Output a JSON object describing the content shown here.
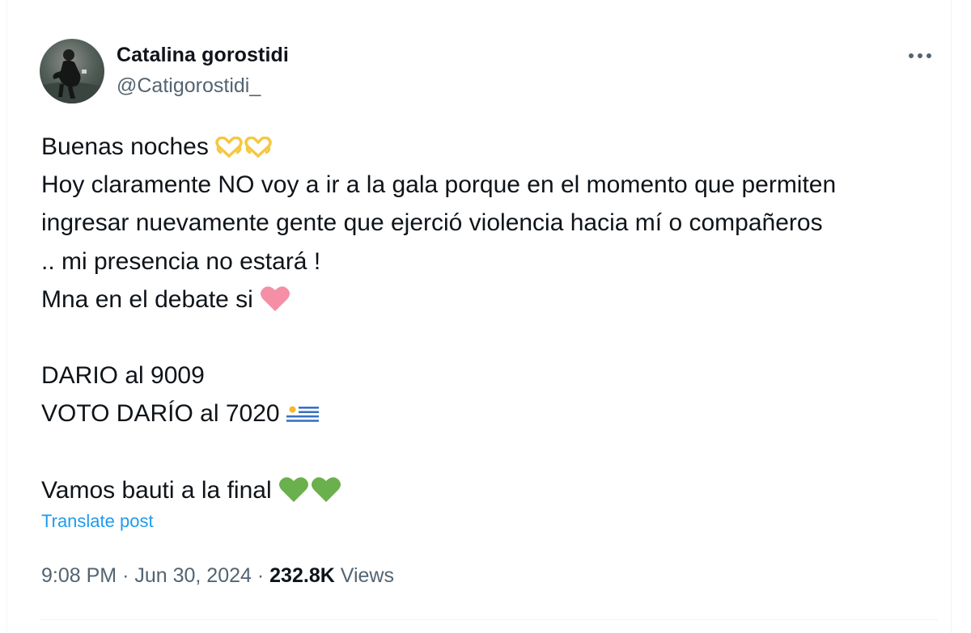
{
  "post": {
    "author": {
      "display_name": "Catalina gorostidi",
      "handle": "@Catigorostidi_"
    },
    "more_icon": "more-horizontal-icon",
    "text": {
      "line1": "Buenas noches",
      "line1_emoji": [
        "heart-hands-emoji",
        "heart-hands-emoji"
      ],
      "line2": "Hoy claramente NO voy a ir a la gala porque en el momento que permiten",
      "line3": "ingresar nuevamente gente que ejerció violencia hacia mí o compañeros",
      "line4": ".. mi presencia no estará !",
      "line5": "Mna en el debate si",
      "line5_emoji": "pink-heart-emoji",
      "line6": "DARIO al 9009",
      "line7": "VOTO DARÍO al 7020",
      "line7_emoji": "uruguay-flag-emoji",
      "line8": "Vamos bauti a la final",
      "line8_emoji": [
        "green-heart-emoji",
        "green-heart-emoji"
      ]
    },
    "translate_label": "Translate post",
    "meta": {
      "time": "9:08 PM",
      "separator": "·",
      "date": "Jun 30, 2024",
      "views_count": "232.8K",
      "views_label": "Views"
    }
  },
  "colors": {
    "text_primary": "#0f1419",
    "text_secondary": "#536471",
    "link": "#1d9bf0",
    "divider": "#eff3f4",
    "heart_hands": "#f5c842",
    "pink_heart": "#f48fa5",
    "green_heart": "#6ab04c"
  }
}
